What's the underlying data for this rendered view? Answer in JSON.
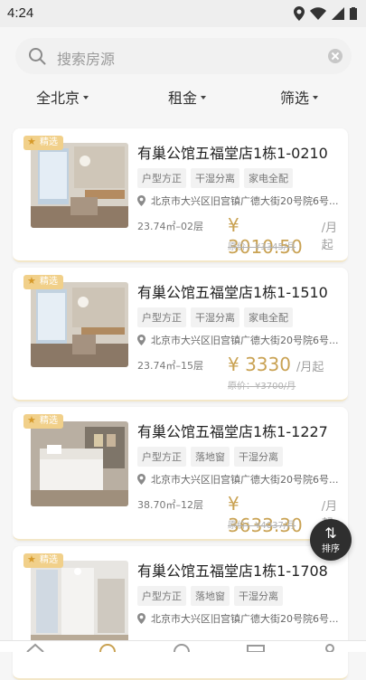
{
  "status": {
    "time": "4:24"
  },
  "search": {
    "placeholder": "搜索房源"
  },
  "filters": [
    "全北京",
    "租金",
    "筛选"
  ],
  "listings": [
    {
      "badge": "精选",
      "title": "有巢公馆五福堂店1栋1-0210",
      "tags": [
        "户型方正",
        "干湿分离",
        "家电全配"
      ],
      "address": "北京市大兴区旧宫镇广德大街20号院6号...",
      "meta": "23.74㎡–02层",
      "price": "¥ 3010.50",
      "price_unit": "/月起",
      "original_price": "原价：¥3345/月"
    },
    {
      "badge": "精选",
      "title": "有巢公馆五福堂店1栋1-1510",
      "tags": [
        "户型方正",
        "干湿分离",
        "家电全配"
      ],
      "address": "北京市大兴区旧宫镇广德大街20号院6号...",
      "meta": "23.74㎡–15层",
      "price": "¥ 3330",
      "price_unit": "/月起",
      "original_price": "原价：¥3700/月"
    },
    {
      "badge": "精选",
      "title": "有巢公馆五福堂店1栋1-1227",
      "tags": [
        "户型方正",
        "落地窗",
        "干湿分离"
      ],
      "address": "北京市大兴区旧宫镇广德大街20号院6号...",
      "meta": "38.70㎡–12层",
      "price": "¥ 3633.30",
      "price_unit": "/月起",
      "original_price": "原价：¥4037/月"
    },
    {
      "badge": "精选",
      "title": "有巢公馆五福堂店1栋1-1708",
      "tags": [
        "户型方正",
        "落地窗",
        "干湿分离"
      ],
      "address": "北京市大兴区旧宫镇广德大街20号院6号...",
      "meta": "",
      "price": "",
      "price_unit": "",
      "original_price": ""
    }
  ],
  "sort_button": {
    "label": "排序"
  },
  "colors": {
    "accent": "#c9a253",
    "badge": "#f1d08a"
  }
}
